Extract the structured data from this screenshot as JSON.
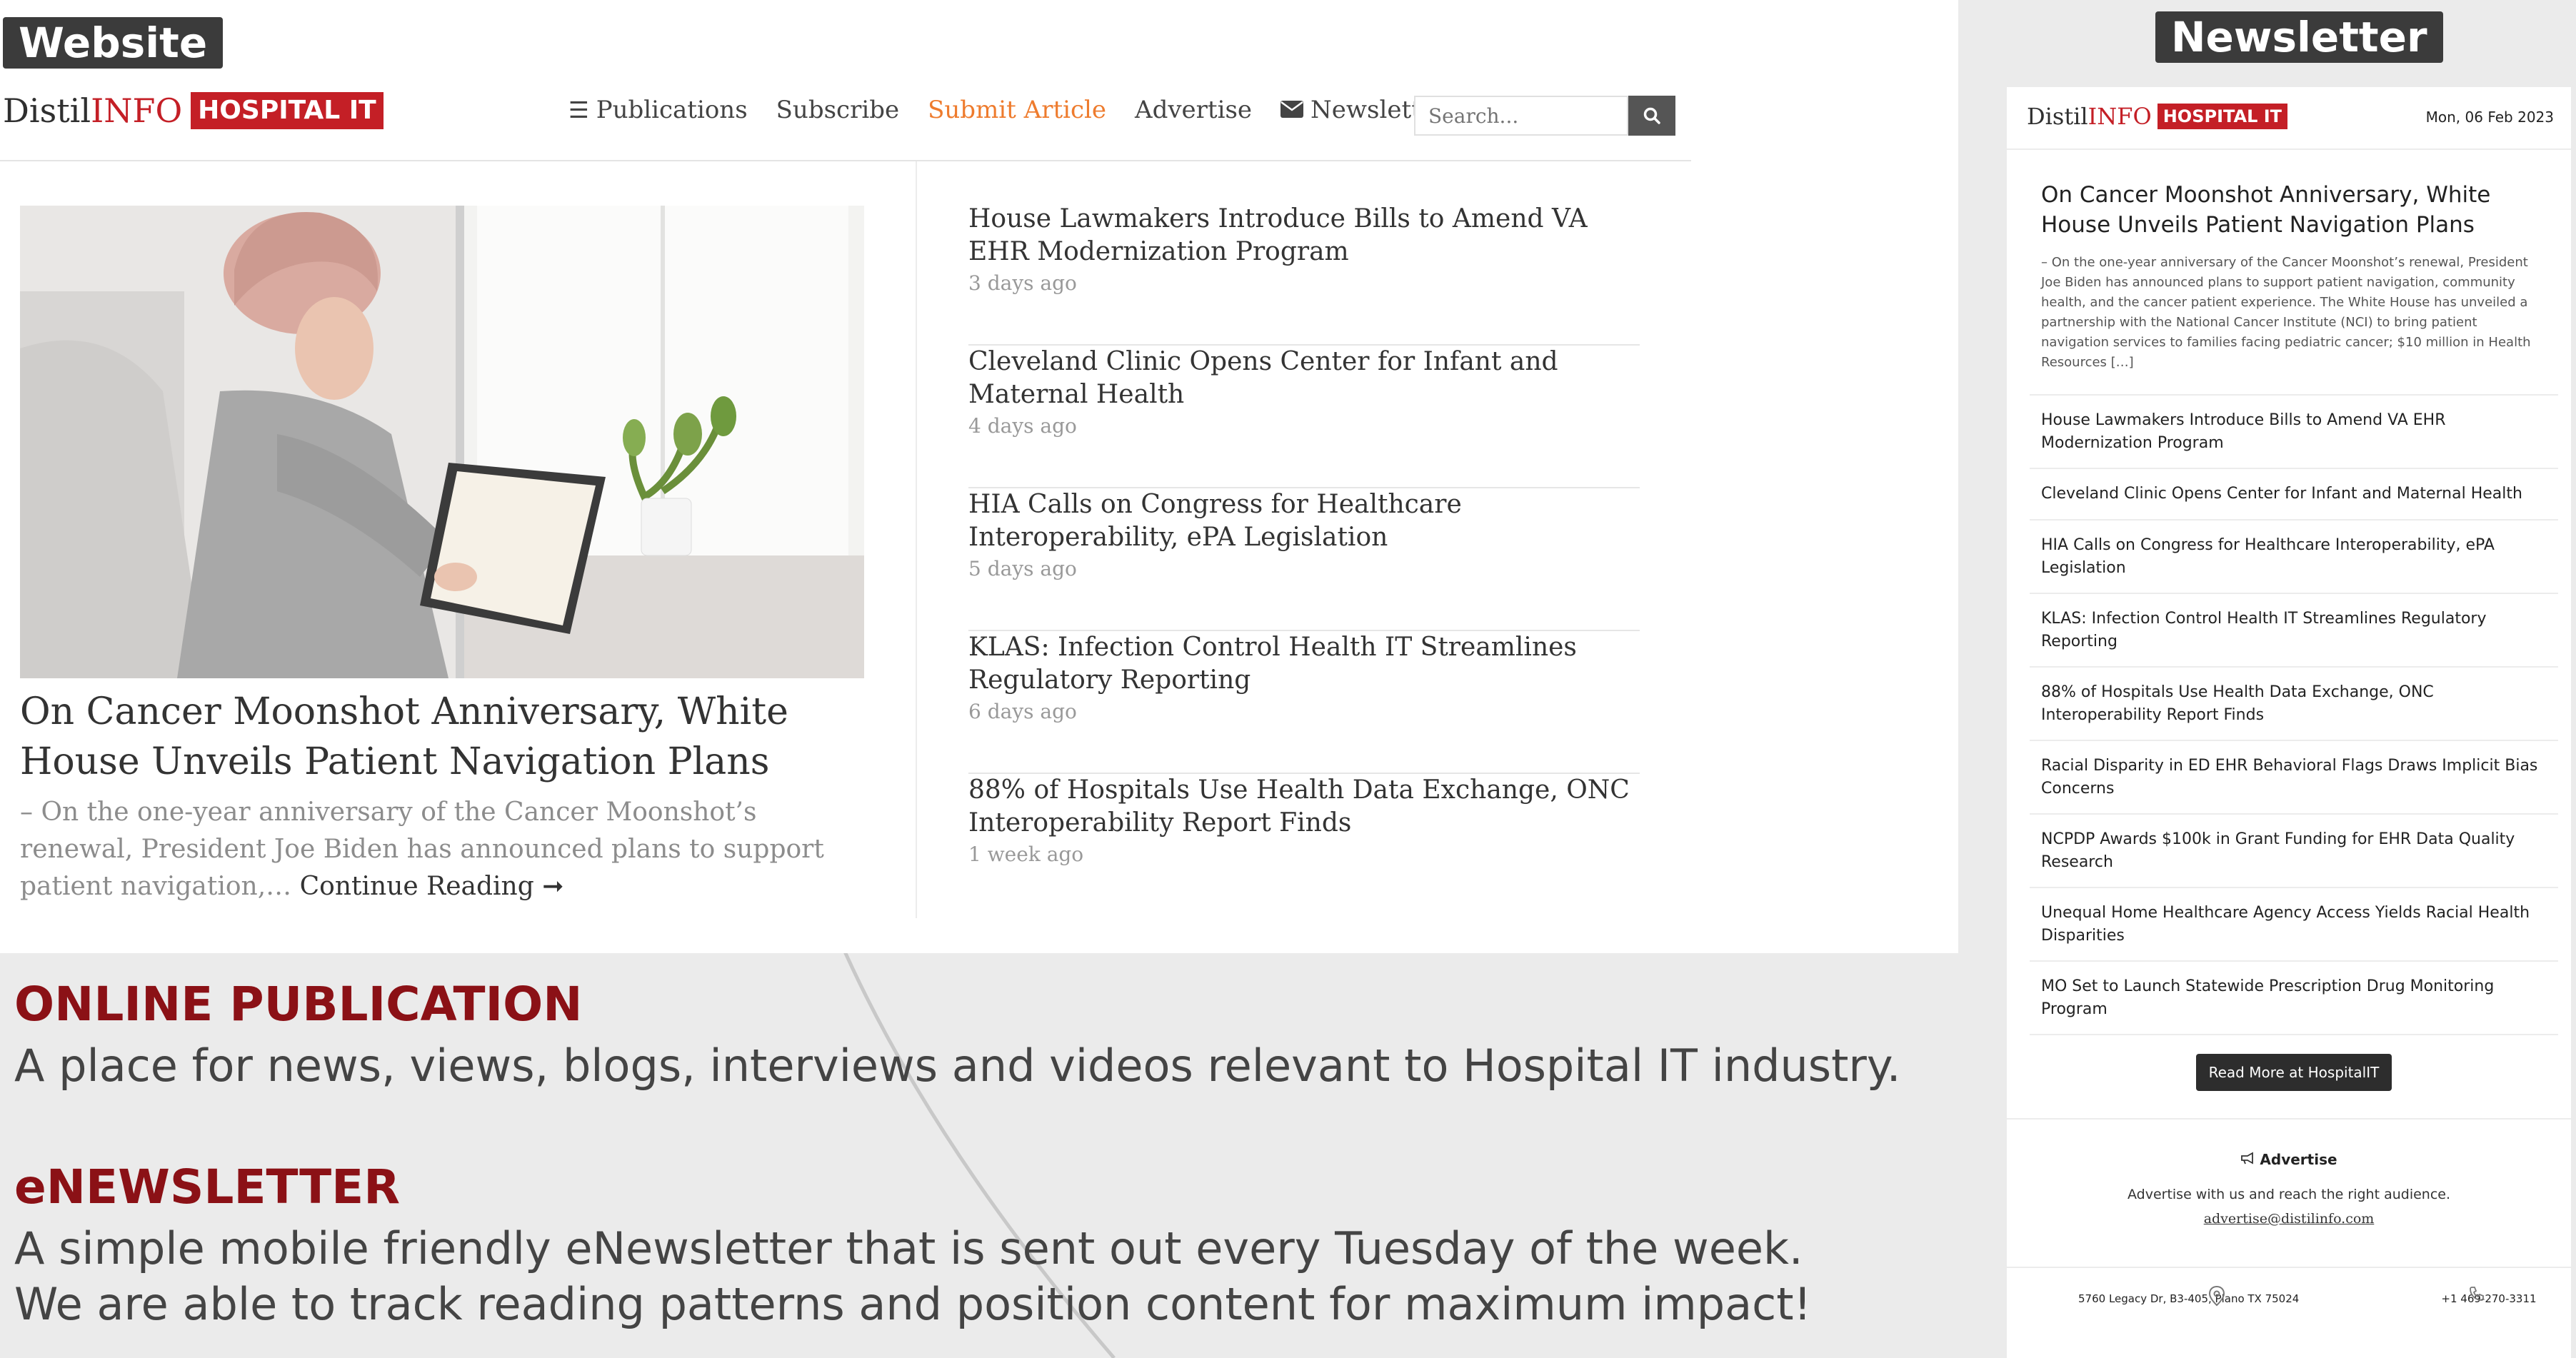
{
  "labels": {
    "website": "Website",
    "newsletter": "Newsletter"
  },
  "site": {
    "logo": {
      "distil": "Distil",
      "info": "INFO",
      "badge": "HOSPITAL IT"
    },
    "nav": {
      "publications": "Publications",
      "subscribe": "Subscribe",
      "submit_article": "Submit Article",
      "advertise": "Advertise",
      "newsletters": "Newsletters"
    },
    "search": {
      "placeholder": "Search..."
    },
    "feature": {
      "title": "On Cancer Moonshot Anniversary, White House Unveils Patient Navigation Plans",
      "excerpt": "– On the one-year anniversary of the Cancer Moonshot’s renewal, President Joe Biden has announced plans to support patient navigation,… ",
      "continue": "Continue Reading"
    },
    "articles": [
      {
        "title": "House Lawmakers Introduce Bills to Amend VA EHR Modernization Program",
        "time": "3 days ago"
      },
      {
        "title": "Cleveland Clinic Opens Center for Infant and Maternal Health",
        "time": "4 days ago"
      },
      {
        "title": "HIA Calls on Congress for Healthcare Interoperability, ePA Legislation",
        "time": "5 days ago"
      },
      {
        "title": "KLAS: Infection Control Health IT Streamlines Regulatory Reporting",
        "time": "6 days ago"
      },
      {
        "title": "88% of Hospitals Use Health Data Exchange, ONC Interoperability Report Finds",
        "time": "1 week ago"
      }
    ],
    "colors": {
      "brand_red": "#c41f26",
      "accent_orange": "#ee7b2d",
      "heading_red": "#8b1116"
    }
  },
  "promo": {
    "online_heading": "ONLINE PUBLICATION",
    "online_text": "A place for news, views, blogs, interviews and videos relevant to Hospital IT industry.",
    "enews_heading": "eNEWSLETTER",
    "enews_text_1": "A simple mobile friendly eNewsletter that is sent out every Tuesday of the week.",
    "enews_text_2": "We are able to track reading patterns and position content for maximum impact!"
  },
  "newsletter": {
    "logo": {
      "distil": "Distil",
      "info": "INFO",
      "badge": "HOSPITAL IT"
    },
    "date": "Mon, 06 Feb 2023",
    "feature": {
      "title": "On Cancer Moonshot Anniversary, White House Unveils Patient Navigation Plans",
      "excerpt": "– On the one-year anniversary of the Cancer Moonshot’s renewal, President Joe Biden has announced plans to support patient navigation, community health, and the cancer patient experience. The White House has unveiled a partnership with the National Cancer Institute (NCI) to bring patient navigation services to families facing pediatric cancer; $10 million in Health Resources […]"
    },
    "items": [
      "House Lawmakers Introduce Bills to Amend VA EHR Modernization Program",
      "Cleveland Clinic Opens Center for Infant and Maternal Health",
      "HIA Calls on Congress for Healthcare Interoperability, ePA Legislation",
      "KLAS: Infection Control Health IT Streamlines Regulatory Reporting",
      "88% of Hospitals Use Health Data Exchange, ONC Interoperability Report Finds",
      "Racial Disparity in ED EHR Behavioral Flags Draws Implicit Bias Concerns",
      "NCPDP Awards $100k in Grant Funding for EHR Data Quality Research",
      "Unequal Home Healthcare Agency Access Yields Racial Health Disparities",
      "MO Set to Launch Statewide Prescription Drug Monitoring Program"
    ],
    "read_more": "Read More at HospitalIT",
    "advertise_title": "Advertise",
    "advertise_text": "Advertise with us and reach the right audience.",
    "advertise_email": "advertise@distilinfo.com",
    "address": "5760 Legacy Dr, B3-405, Plano TX 75024",
    "phone": "+1 469-270-3311"
  }
}
